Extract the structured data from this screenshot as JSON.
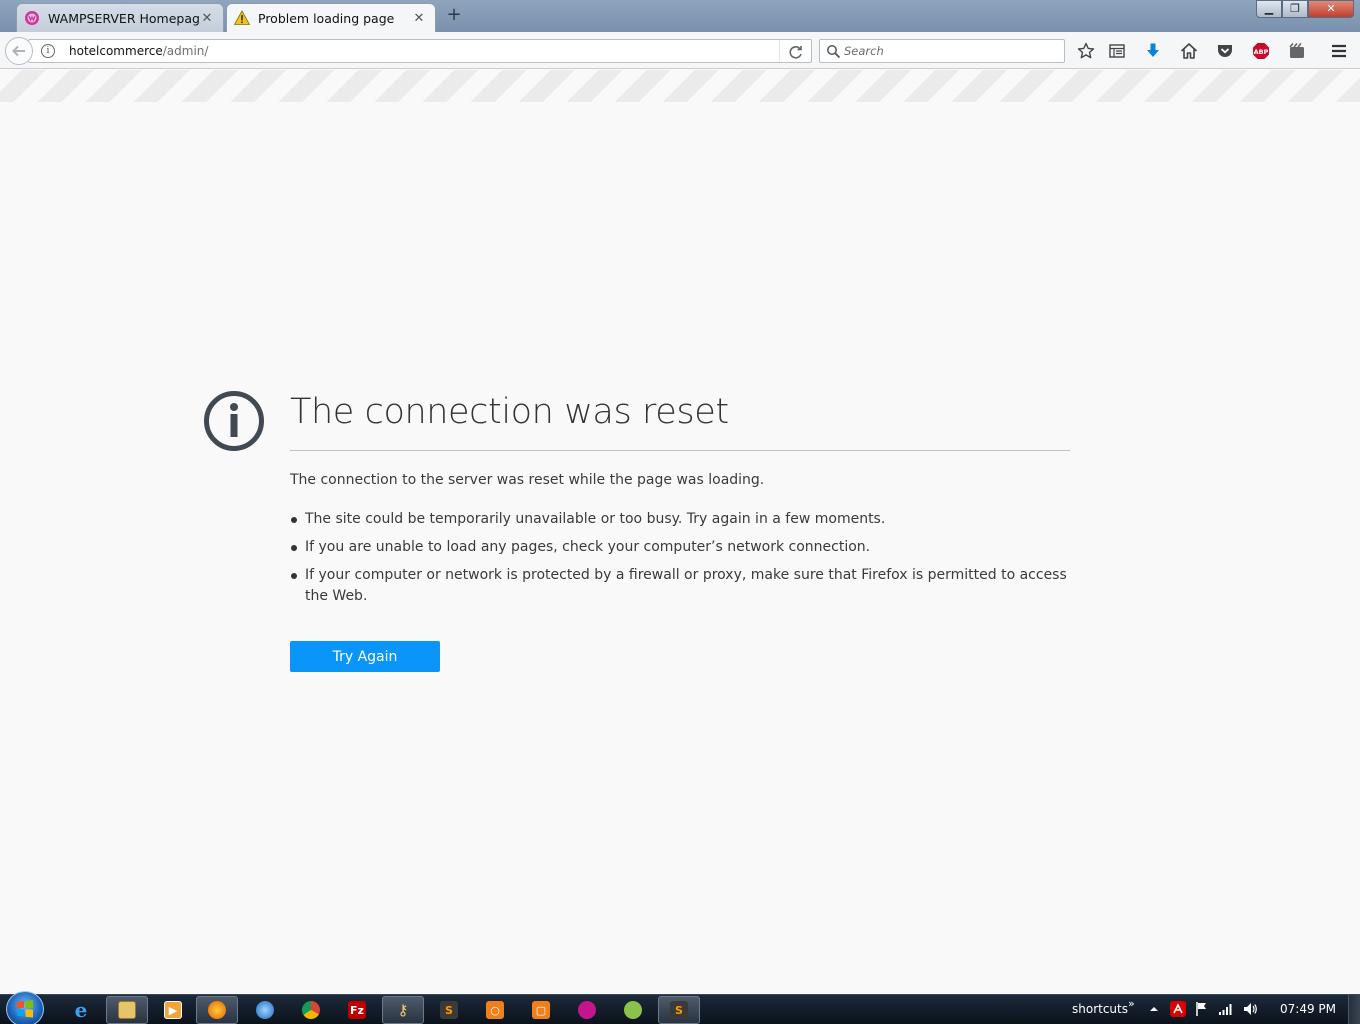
{
  "tabs": [
    {
      "title": "WAMPSERVER Homepage",
      "icon": "wampserver-icon",
      "active": false
    },
    {
      "title": "Problem loading page",
      "icon": "warning-icon",
      "active": true
    }
  ],
  "toolbar": {
    "url_host": "hotelcommerce",
    "url_path": "/admin/",
    "search_placeholder": "Search",
    "icons": [
      "back-icon",
      "info-icon",
      "reload-icon",
      "search-icon",
      "bookmark-star-icon",
      "reading-list-icon",
      "download-icon",
      "home-icon",
      "pocket-icon",
      "adblock-icon",
      "screenshot-icon",
      "menu-icon"
    ],
    "abp_label": "ABP"
  },
  "error": {
    "title": "The connection was reset",
    "description": "The connection to the server was reset while the page was loading.",
    "items": [
      "The site could be temporarily unavailable or too busy. Try again in a few moments.",
      "If you are unable to load any pages, check your computer’s network connection.",
      "If your computer or network is protected by a firewall or proxy, make sure that Firefox is permitted to access the Web."
    ],
    "button_label": "Try Again"
  },
  "taskbar": {
    "apps": [
      "internet-explorer-icon",
      "file-explorer-icon",
      "media-player-icon",
      "firefox-icon",
      "thunderbird-icon",
      "chrome-icon",
      "filezilla-icon",
      "keys-icon",
      "sublime-icon",
      "app-orange-icon",
      "app-orange2-icon",
      "wamp-icon",
      "android-icon",
      "sublime2-icon"
    ],
    "filezilla_label": "Fz",
    "shortcuts_label": "shortcuts",
    "shortcuts_chevron": "»",
    "clock": "07:49 PM"
  },
  "colors": {
    "accent": "#0996f8",
    "title_text": "#333333",
    "body_text": "#3a3a3a",
    "stripe": "#ebebeb"
  }
}
